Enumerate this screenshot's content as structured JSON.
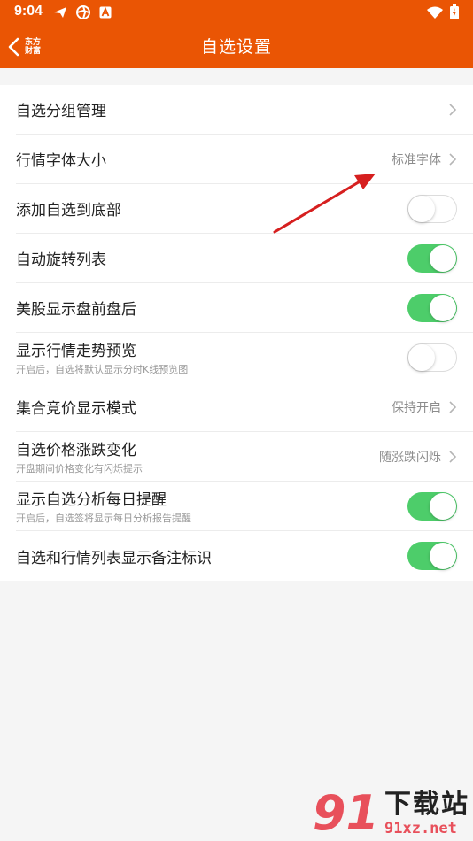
{
  "status_bar": {
    "time": "9:04"
  },
  "header": {
    "back_brand_line1": "东方",
    "back_brand_line2": "财富",
    "title": "自选设置"
  },
  "colors": {
    "accent": "#ea5504",
    "toggle_on": "#4dcd6a",
    "annotation": "#d61f1f"
  },
  "rows": [
    {
      "title": "自选分组管理",
      "subtitle": "",
      "value": "",
      "control": "chevron"
    },
    {
      "title": "行情字体大小",
      "subtitle": "",
      "value": "标准字体",
      "control": "chevron"
    },
    {
      "title": "添加自选到底部",
      "subtitle": "",
      "value": "",
      "control": "toggle",
      "on": false
    },
    {
      "title": "自动旋转列表",
      "subtitle": "",
      "value": "",
      "control": "toggle",
      "on": true
    },
    {
      "title": "美股显示盘前盘后",
      "subtitle": "",
      "value": "",
      "control": "toggle",
      "on": true
    },
    {
      "title": "显示行情走势预览",
      "subtitle": "开启后，自选将默认显示分时K线预览图",
      "value": "",
      "control": "toggle",
      "on": false
    },
    {
      "title": "集合竞价显示模式",
      "subtitle": "",
      "value": "保持开启",
      "control": "chevron"
    },
    {
      "title": "自选价格涨跌变化",
      "subtitle": "开盘期间价格变化有闪烁提示",
      "value": "随涨跌闪烁",
      "control": "chevron"
    },
    {
      "title": "显示自选分析每日提醒",
      "subtitle": "开启后，自选签将显示每日分析报告提醒",
      "value": "",
      "control": "toggle",
      "on": true
    },
    {
      "title": "自选和行情列表显示备注标识",
      "subtitle": "",
      "value": "",
      "control": "toggle",
      "on": true
    }
  ],
  "watermark": {
    "logo": "91",
    "text": "下载站",
    "url": "91xz.net"
  }
}
